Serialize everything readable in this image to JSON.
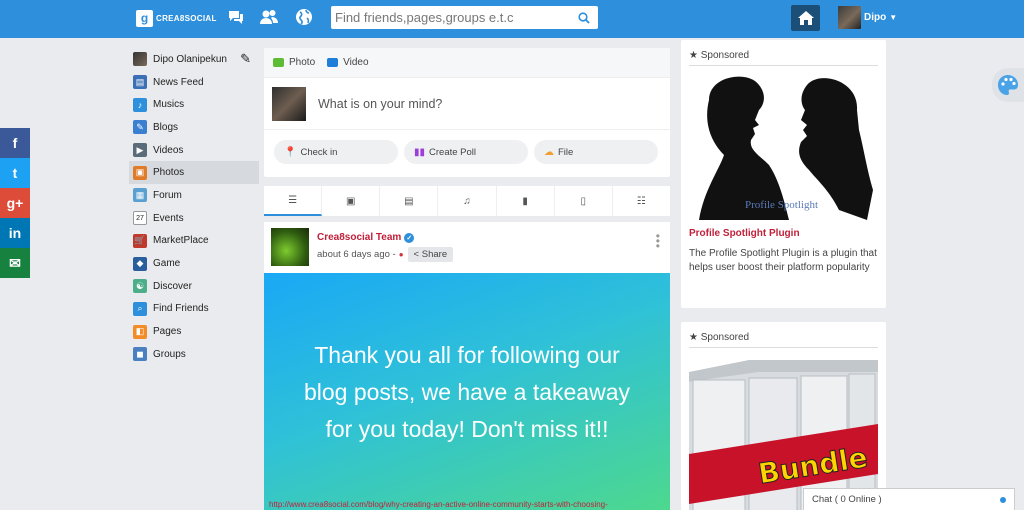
{
  "header": {
    "logo_mark": "g",
    "logo_text": "CREA8SOCIAL",
    "search_placeholder": "Find friends,pages,groups e.t.c",
    "user_name": "Dipo"
  },
  "social_share": [
    {
      "glyph": "f",
      "icon": "facebook-icon",
      "color": "#3b5998"
    },
    {
      "glyph": "t",
      "icon": "twitter-icon",
      "color": "#1da1f2"
    },
    {
      "glyph": "g+",
      "icon": "google-plus-icon",
      "color": "#dd4b39"
    },
    {
      "glyph": "in",
      "icon": "linkedin-icon",
      "color": "#0077b5"
    },
    {
      "glyph": "✉",
      "icon": "email-icon",
      "color": "#17813f"
    }
  ],
  "sidebar": {
    "profile_name": "Dipo Olanipekun",
    "items": [
      {
        "label": "News Feed",
        "icon": "news-feed-icon"
      },
      {
        "label": "Musics",
        "icon": "music-icon"
      },
      {
        "label": "Blogs",
        "icon": "blog-icon"
      },
      {
        "label": "Videos",
        "icon": "video-icon"
      },
      {
        "label": "Photos",
        "icon": "photo-icon"
      },
      {
        "label": "Forum",
        "icon": "forum-icon"
      },
      {
        "label": "Events",
        "icon": "calendar-icon"
      },
      {
        "label": "MarketPlace",
        "icon": "cart-icon"
      },
      {
        "label": "Game",
        "icon": "game-icon"
      },
      {
        "label": "Discover",
        "icon": "discover-icon"
      },
      {
        "label": "Find Friends",
        "icon": "find-friends-icon"
      },
      {
        "label": "Pages",
        "icon": "pages-icon"
      },
      {
        "label": "Groups",
        "icon": "groups-icon"
      }
    ],
    "events_day": "27"
  },
  "composer": {
    "tab_photo": "Photo",
    "tab_video": "Video",
    "placeholder": "What is on your mind?",
    "checkin": "Check in",
    "poll": "Create Poll",
    "file": "File"
  },
  "post": {
    "author": "Crea8social Team",
    "time": "about 6 days ago -",
    "share": "Share",
    "banner_lines": [
      "Thank you all for following our",
      "blog posts, we have a takeaway",
      "for you today! Don't miss it!!"
    ],
    "link": "http://www.crea8social.com/blog/why-creating-an-active-online-community-starts-with-choosing-"
  },
  "sponsored": [
    {
      "heading": "★ Sponsored",
      "image_caption": "Profile Spotlight",
      "title": "Profile Spotlight Plugin",
      "description": "The Profile Spotlight Plugin is a plugin that helps user boost their platform popularity"
    },
    {
      "heading": "★ Sponsored",
      "image_caption": "Bundle"
    }
  ],
  "chat": {
    "label": "Chat ( 0 Online )"
  },
  "colors": {
    "header": "#2e8fdc",
    "accent_red": "#c0203a",
    "home_button": "#1c4f78"
  }
}
